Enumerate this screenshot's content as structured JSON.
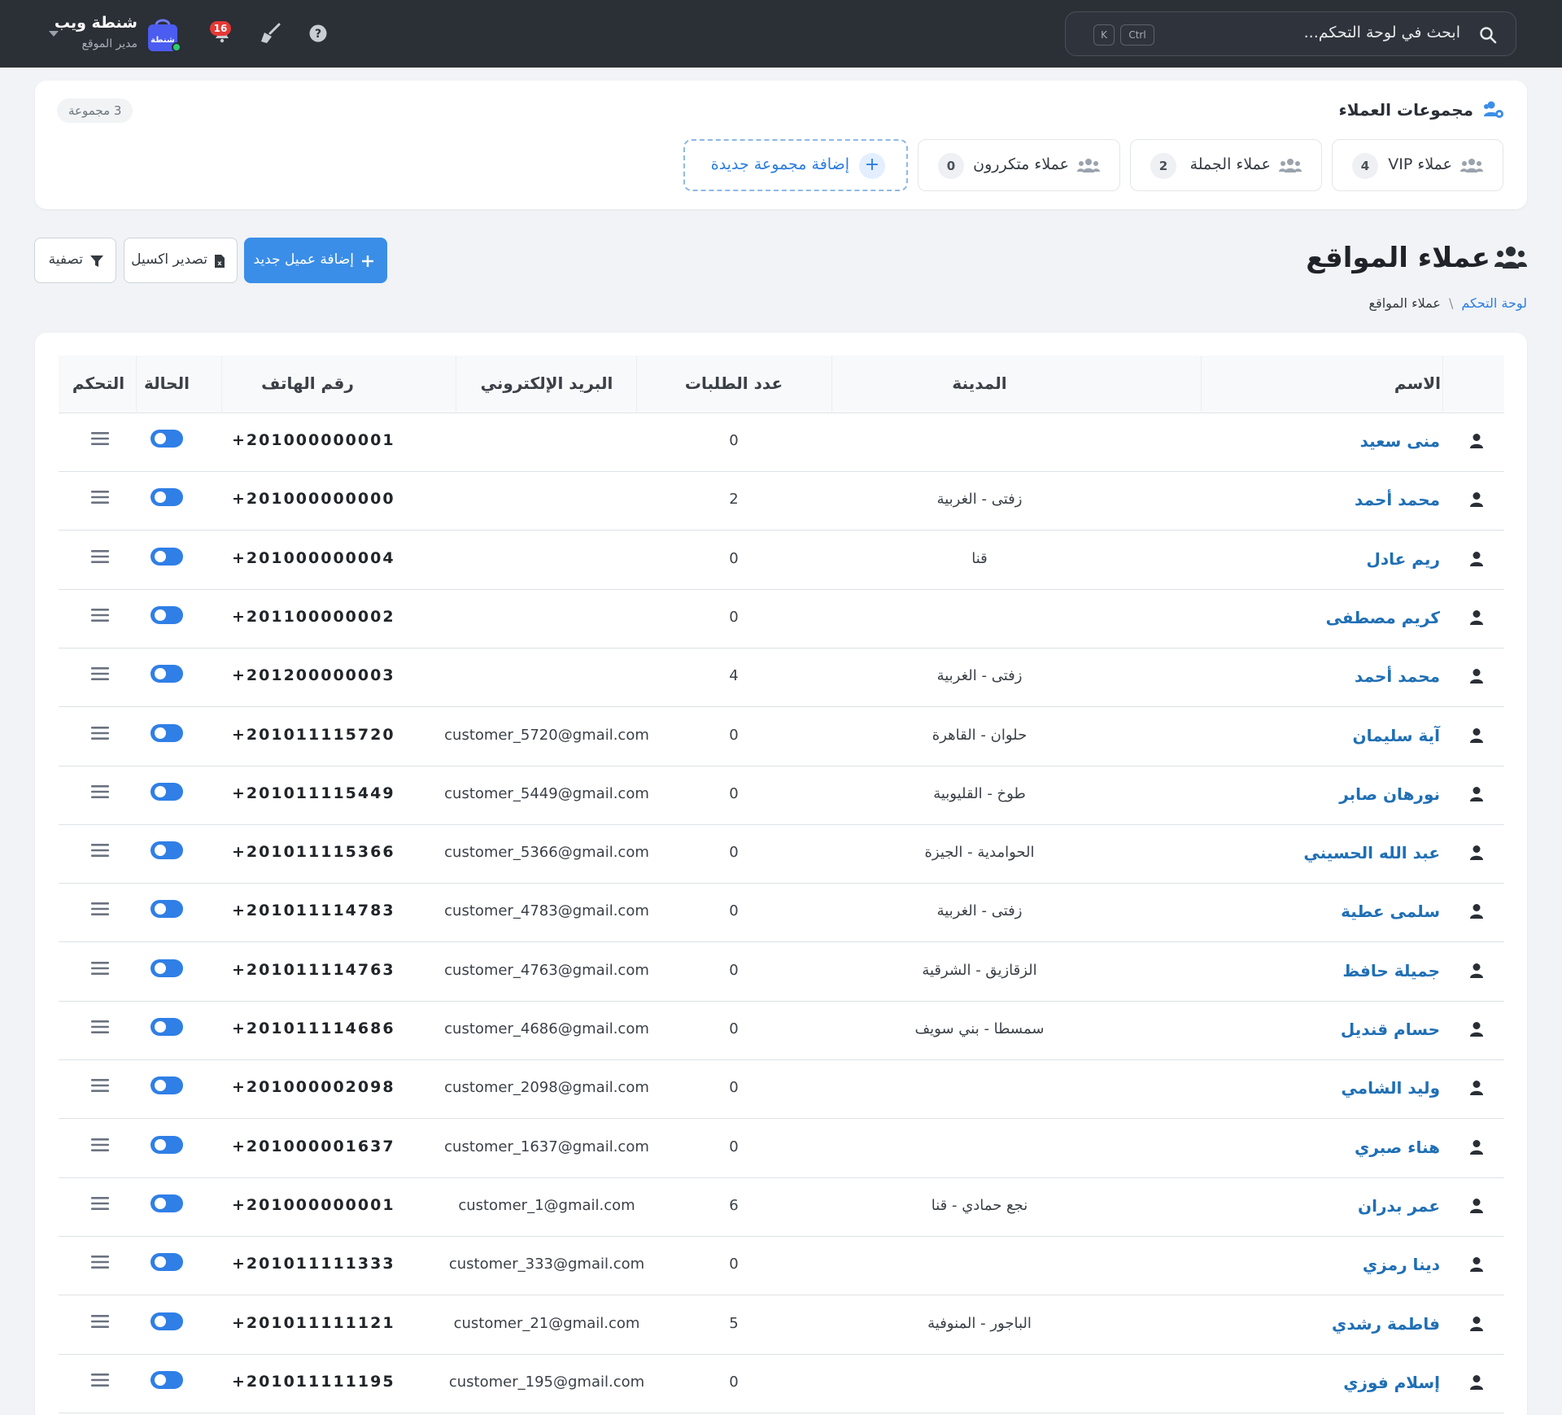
{
  "topbar": {
    "search_placeholder": "ابحث في لوحة التحكم...",
    "shortcut_key1": "Ctrl",
    "shortcut_key2": "K",
    "notifications_count": "16",
    "user_name": "شنطة ويب",
    "user_role": "مدير الموقع",
    "logo_text": "شنطة"
  },
  "groups": {
    "title": "مجموعات العملاء",
    "count_label": "3 مجموعة",
    "items": [
      {
        "label": "عملاء VIP",
        "count": "4"
      },
      {
        "label": "عملاء الجملة",
        "count": "2"
      },
      {
        "label": "عملاء متكررون",
        "count": "0"
      }
    ],
    "add_label": "إضافة مجموعة جديدة"
  },
  "page": {
    "title": "عملاء المواقع",
    "breadcrumb": {
      "home": "لوحة التحكم",
      "separator": "\\",
      "current": "عملاء المواقع"
    },
    "add_customer_label": "إضافة عميل جديد",
    "export_label": "تصدير اكسيل",
    "filter_label": "تصفية"
  },
  "table": {
    "columns": {
      "name": "الاسم",
      "city": "المدينة",
      "orders": "عدد الطلبات",
      "email": "البريد الإلكتروني",
      "phone": "رقم الهاتف",
      "status": "الحالة",
      "actions": "التحكم"
    },
    "rows": [
      {
        "name": "منى سعيد",
        "city": "",
        "orders": "0",
        "email": "",
        "phone": "+201000000001"
      },
      {
        "name": "محمد أحمد",
        "city": "زفتى - الغربية",
        "orders": "2",
        "email": "",
        "phone": "+201000000000"
      },
      {
        "name": "ريم عادل",
        "city": "قنا",
        "orders": "0",
        "email": "",
        "phone": "+201000000004"
      },
      {
        "name": "كريم مصطفى",
        "city": "",
        "orders": "0",
        "email": "",
        "phone": "+201100000002"
      },
      {
        "name": "محمد أحمد",
        "city": "زفتى - الغربية",
        "orders": "4",
        "email": "",
        "phone": "+201200000003"
      },
      {
        "name": "آية سليمان",
        "city": "حلوان - القاهرة",
        "orders": "0",
        "email": "customer_5720@gmail.com",
        "phone": "+201011115720"
      },
      {
        "name": "نورهان صابر",
        "city": "طوخ - القليوبية",
        "orders": "0",
        "email": "customer_5449@gmail.com",
        "phone": "+201011115449"
      },
      {
        "name": "عبد الله الحسيني",
        "city": "الحوامدية - الجيزة",
        "orders": "0",
        "email": "customer_5366@gmail.com",
        "phone": "+201011115366"
      },
      {
        "name": "سلمى عطية",
        "city": "زفتى - الغربية",
        "orders": "0",
        "email": "customer_4783@gmail.com",
        "phone": "+201011114783"
      },
      {
        "name": "جميلة حافظ",
        "city": "الزقازيق - الشرقية",
        "orders": "0",
        "email": "customer_4763@gmail.com",
        "phone": "+201011114763"
      },
      {
        "name": "حسام قنديل",
        "city": "سمسطا - بني سويف",
        "orders": "0",
        "email": "customer_4686@gmail.com",
        "phone": "+201011114686"
      },
      {
        "name": "وليد الشامي",
        "city": "",
        "orders": "0",
        "email": "customer_2098@gmail.com",
        "phone": "+201000002098"
      },
      {
        "name": "هناء صبري",
        "city": "",
        "orders": "0",
        "email": "customer_1637@gmail.com",
        "phone": "+201000001637"
      },
      {
        "name": "عمر بدران",
        "city": "نجع حمادي - قنا",
        "orders": "6",
        "email": "customer_1@gmail.com",
        "phone": "+201000000001"
      },
      {
        "name": "دينا رمزي",
        "city": "",
        "orders": "0",
        "email": "customer_333@gmail.com",
        "phone": "+201011111333"
      },
      {
        "name": "فاطمة رشدي",
        "city": "الباجور - المنوفية",
        "orders": "5",
        "email": "customer_21@gmail.com",
        "phone": "+201011111121"
      },
      {
        "name": "إسلام فوزي",
        "city": "",
        "orders": "0",
        "email": "customer_195@gmail.com",
        "phone": "+201011111195"
      }
    ]
  },
  "colors": {
    "topbar_bg": "#2b2f36",
    "accent": "#3a8ee8",
    "name_link": "#1f6fb5",
    "toggle_on": "#2f7fe6",
    "badge": "#e53935"
  }
}
